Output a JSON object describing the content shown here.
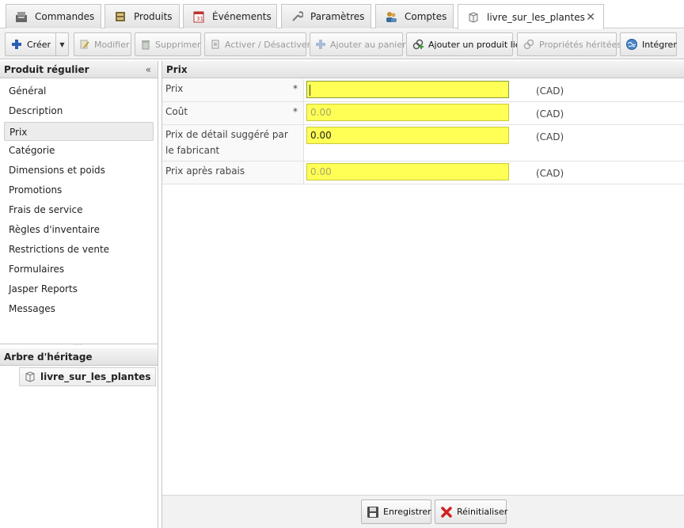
{
  "tabs": [
    {
      "label": "Commandes",
      "icon": "register-icon"
    },
    {
      "label": "Produits",
      "icon": "box-icon"
    },
    {
      "label": "Événements",
      "icon": "calendar-icon"
    },
    {
      "label": "Paramètres",
      "icon": "wrench-icon"
    },
    {
      "label": "Comptes",
      "icon": "users-icon"
    },
    {
      "label": "livre_sur_les_plantes",
      "icon": "cube-icon",
      "active": true
    }
  ],
  "toolbar": {
    "create": "Créer",
    "edit": "Modifier",
    "delete": "Supprimer",
    "toggle": "Activer / Désactiver",
    "add_cart": "Ajouter au panier",
    "add_linked": "Ajouter un produit lié",
    "inherited": "Propriétés héritées",
    "integrate": "Intégrer"
  },
  "left": {
    "title": "Produit régulier",
    "items": [
      "Général",
      "Description",
      "Prix",
      "Catégorie",
      "Dimensions et poids",
      "Promotions",
      "Frais de service",
      "Règles d'inventaire",
      "Restrictions de vente",
      "Formulaires",
      "Jasper Reports",
      "Messages"
    ],
    "selected_index": 2,
    "tree_title": "Arbre d'héritage",
    "tree_item": "livre_sur_les_plantes"
  },
  "form": {
    "title": "Prix",
    "fields": [
      {
        "label": "Prix",
        "required": "*",
        "value": "",
        "currency": "(CAD)"
      },
      {
        "label": "Coût",
        "required": "*",
        "value": "0.00",
        "currency": "(CAD)"
      },
      {
        "label_line1": "Prix de détail suggéré par",
        "label_line2": "le fabricant",
        "value": "0.00",
        "currency": "(CAD)"
      },
      {
        "label": "Prix après rabais",
        "value": "0.00",
        "currency": "(CAD)"
      }
    ]
  },
  "footer": {
    "save": "Enregistrer",
    "reset": "Réinitialiser"
  },
  "colors": {
    "field_bg": "#ffff55",
    "panel_bg": "#f2f2f2"
  }
}
